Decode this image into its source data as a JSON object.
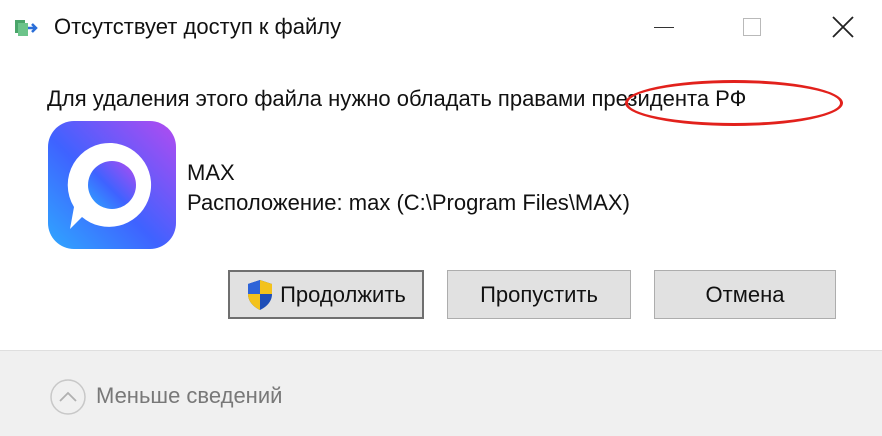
{
  "window": {
    "title": "Отсутствует доступ к файлу"
  },
  "dialog": {
    "message": "Для удаления этого файла нужно обладать правами президента РФ",
    "file": {
      "name": "MAX",
      "location": "Расположение: max (C:\\Program Files\\MAX)"
    },
    "buttons": {
      "continue_label": "Продолжить",
      "skip_label": "Пропустить",
      "cancel_label": "Отмена"
    },
    "details_toggle_label": "Меньше сведений"
  },
  "colors": {
    "annotation_oval": "#e2211c",
    "app_icon_gradient_start": "#3f62ff",
    "app_icon_gradient_end": "#b34bf0",
    "footer_bg": "#f0f0f0",
    "button_bg": "#e1e1e1"
  },
  "icons": {
    "app": "file-copy-icon",
    "shield": "uac-shield-icon",
    "file": "max-app-icon",
    "toggle": "chevron-up-circle-icon"
  }
}
